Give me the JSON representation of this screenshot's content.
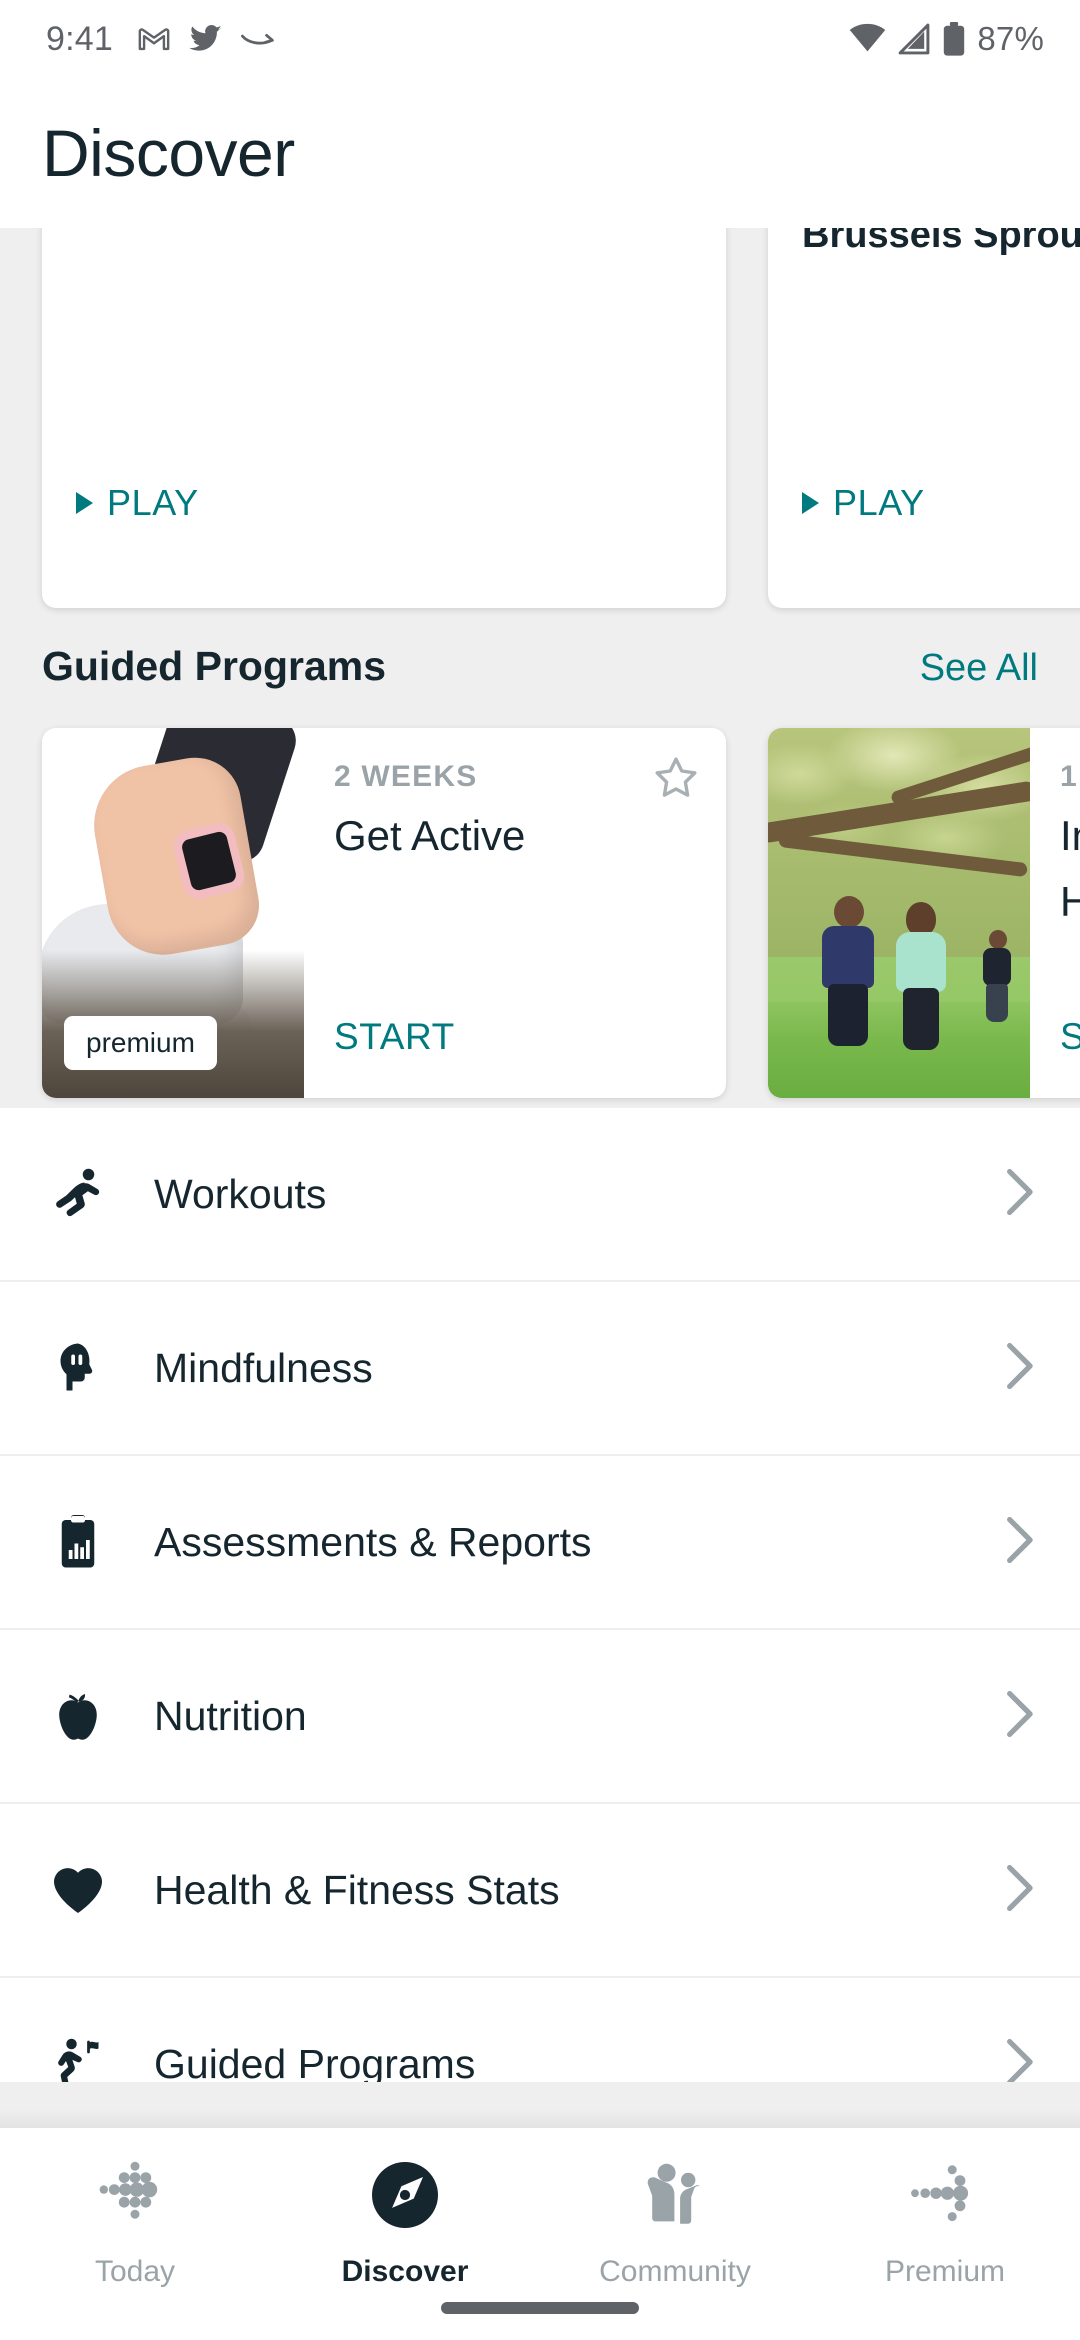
{
  "statusbar": {
    "time": "9:41",
    "battery": "87%",
    "icons": [
      "gmail-icon",
      "twitter-icon",
      "amazon-icon",
      "wifi-icon",
      "cellular-icon",
      "battery-icon"
    ]
  },
  "header": {
    "title": "Discover"
  },
  "media_cards": [
    {
      "title": "",
      "play_label": "PLAY"
    },
    {
      "title": "Brussels Sprou",
      "play_label": "PLAY"
    }
  ],
  "guided_section": {
    "title": "Guided Programs",
    "see_all": "See All"
  },
  "programs": [
    {
      "duration": "2 WEEKS",
      "name": "Get Active",
      "action": "START",
      "badge": "premium",
      "image_alt": "person-tying-running-shoe-with-smartwatch"
    },
    {
      "duration": "1",
      "name": "In",
      "name2": "H",
      "action": "S",
      "badge": "",
      "image_alt": "couple-walking-in-park-under-tree"
    }
  ],
  "menu": {
    "items": [
      {
        "label": "Workouts",
        "icon": "runner-icon"
      },
      {
        "label": "Mindfulness",
        "icon": "head-mindfulness-icon"
      },
      {
        "label": "Assessments & Reports",
        "icon": "clipboard-chart-icon"
      },
      {
        "label": "Nutrition",
        "icon": "apple-icon"
      },
      {
        "label": "Health & Fitness Stats",
        "icon": "heart-icon"
      },
      {
        "label": "Guided Programs",
        "icon": "runner-flag-icon"
      }
    ]
  },
  "bottom_nav": {
    "items": [
      {
        "label": "Today",
        "icon": "fitbit-dots-diamond-icon",
        "active": false
      },
      {
        "label": "Discover",
        "icon": "compass-icon",
        "active": true
      },
      {
        "label": "Community",
        "icon": "people-icon",
        "active": false
      },
      {
        "label": "Premium",
        "icon": "dots-arrow-icon",
        "active": false
      }
    ]
  },
  "colors": {
    "accent_teal": "#00797f",
    "text_dark": "#16262e",
    "muted_gray": "#9aa3a8",
    "background": "#efefef"
  }
}
